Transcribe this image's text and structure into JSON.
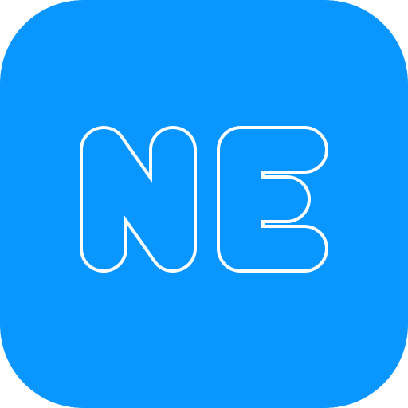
{
  "icon": {
    "name": "ne-monogram-icon",
    "text": "NE",
    "colors": {
      "background": "#0A96FF",
      "stroke": "#FFFFFF"
    }
  }
}
